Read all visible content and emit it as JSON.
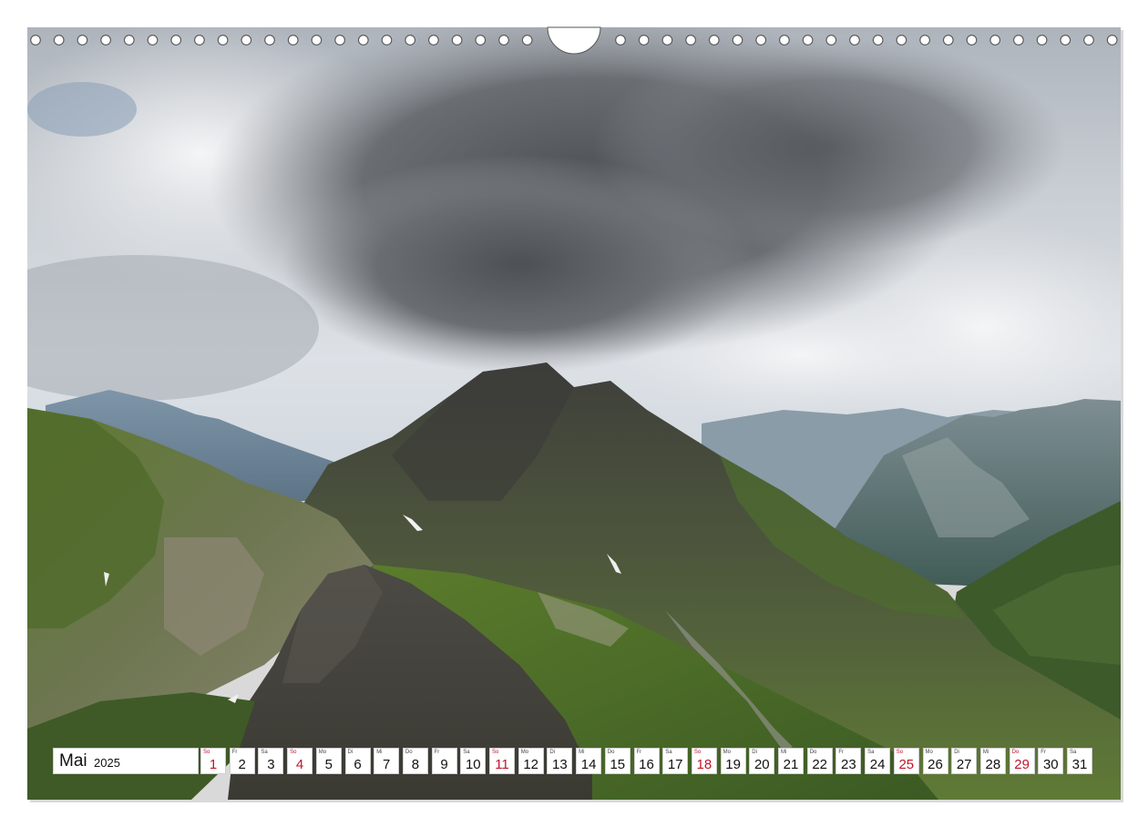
{
  "calendar": {
    "month": "Mai",
    "year": "2025",
    "days": [
      {
        "wd": "So",
        "d": "1",
        "sunday": true
      },
      {
        "wd": "Fr",
        "d": "2",
        "sunday": false
      },
      {
        "wd": "Sa",
        "d": "3",
        "sunday": false
      },
      {
        "wd": "So",
        "d": "4",
        "sunday": true
      },
      {
        "wd": "Mo",
        "d": "5",
        "sunday": false
      },
      {
        "wd": "Di",
        "d": "6",
        "sunday": false
      },
      {
        "wd": "Mi",
        "d": "7",
        "sunday": false
      },
      {
        "wd": "Do",
        "d": "8",
        "sunday": false
      },
      {
        "wd": "Fr",
        "d": "9",
        "sunday": false
      },
      {
        "wd": "Sa",
        "d": "10",
        "sunday": false
      },
      {
        "wd": "So",
        "d": "11",
        "sunday": true
      },
      {
        "wd": "Mo",
        "d": "12",
        "sunday": false
      },
      {
        "wd": "Di",
        "d": "13",
        "sunday": false
      },
      {
        "wd": "Mi",
        "d": "14",
        "sunday": false
      },
      {
        "wd": "Do",
        "d": "15",
        "sunday": false
      },
      {
        "wd": "Fr",
        "d": "16",
        "sunday": false
      },
      {
        "wd": "Sa",
        "d": "17",
        "sunday": false
      },
      {
        "wd": "So",
        "d": "18",
        "sunday": true
      },
      {
        "wd": "Mo",
        "d": "19",
        "sunday": false
      },
      {
        "wd": "Di",
        "d": "20",
        "sunday": false
      },
      {
        "wd": "Mi",
        "d": "21",
        "sunday": false
      },
      {
        "wd": "Do",
        "d": "22",
        "sunday": false
      },
      {
        "wd": "Fr",
        "d": "23",
        "sunday": false
      },
      {
        "wd": "Sa",
        "d": "24",
        "sunday": false
      },
      {
        "wd": "So",
        "d": "25",
        "sunday": true
      },
      {
        "wd": "Mo",
        "d": "26",
        "sunday": false
      },
      {
        "wd": "Di",
        "d": "27",
        "sunday": false
      },
      {
        "wd": "Mi",
        "d": "28",
        "sunday": false
      },
      {
        "wd": "Do",
        "d": "29",
        "sunday": true
      },
      {
        "wd": "Fr",
        "d": "30",
        "sunday": false
      },
      {
        "wd": "Sa",
        "d": "31",
        "sunday": false
      }
    ]
  },
  "colors": {
    "holiday_red": "#c0152a",
    "cell_background": "#ffffff",
    "sky_cloud_dark": "#5b5f64",
    "meadow_green": "#6f8a35"
  },
  "icons": {
    "binding": "spiral-binding-holes",
    "hanger": "hanger-notch"
  }
}
